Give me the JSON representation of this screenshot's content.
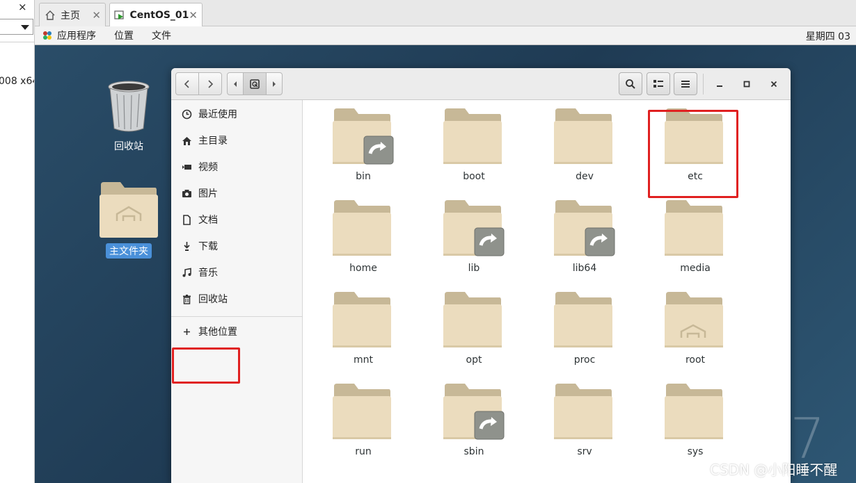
{
  "host": {
    "close_glyph": "×",
    "vm_text": "008 x64"
  },
  "tabs": [
    {
      "label": "主页",
      "icon": "home-icon"
    },
    {
      "label": "CentOS_01",
      "icon": "vm-icon"
    }
  ],
  "tab_close": "✕",
  "gnome_bar": {
    "apps": "应用程序",
    "places": "位置",
    "files": "文件",
    "clock": "星期四 03"
  },
  "desktop": {
    "trash_label": "回收站",
    "home_label": "主文件夹",
    "seven": "7"
  },
  "sidebar": {
    "items": [
      {
        "label": "最近使用",
        "icon": "recent-icon"
      },
      {
        "label": "主目录",
        "icon": "home-icon"
      },
      {
        "label": "视频",
        "icon": "video-icon"
      },
      {
        "label": "图片",
        "icon": "camera-icon"
      },
      {
        "label": "文档",
        "icon": "document-icon"
      },
      {
        "label": "下载",
        "icon": "download-icon"
      },
      {
        "label": "音乐",
        "icon": "music-icon"
      },
      {
        "label": "回收站",
        "icon": "trash-icon"
      }
    ],
    "other_locations": {
      "label": "其他位置",
      "icon": "plus-icon"
    }
  },
  "files": [
    {
      "name": "bin",
      "type": "link"
    },
    {
      "name": "boot",
      "type": "folder"
    },
    {
      "name": "dev",
      "type": "folder"
    },
    {
      "name": "etc",
      "type": "folder"
    },
    {
      "name": "home",
      "type": "folder"
    },
    {
      "name": "lib",
      "type": "link"
    },
    {
      "name": "lib64",
      "type": "link"
    },
    {
      "name": "media",
      "type": "folder"
    },
    {
      "name": "mnt",
      "type": "folder"
    },
    {
      "name": "opt",
      "type": "folder"
    },
    {
      "name": "proc",
      "type": "folder"
    },
    {
      "name": "root",
      "type": "home"
    },
    {
      "name": "run",
      "type": "folder"
    },
    {
      "name": "sbin",
      "type": "link"
    },
    {
      "name": "srv",
      "type": "folder"
    },
    {
      "name": "sys",
      "type": "folder"
    }
  ],
  "colors": {
    "highlight": "#e02020",
    "selection": "#4a90d9",
    "folder_tab": "#c7b897",
    "folder_body": "#ebdcbe"
  },
  "watermark": "CSDN @小阳睡不醒"
}
